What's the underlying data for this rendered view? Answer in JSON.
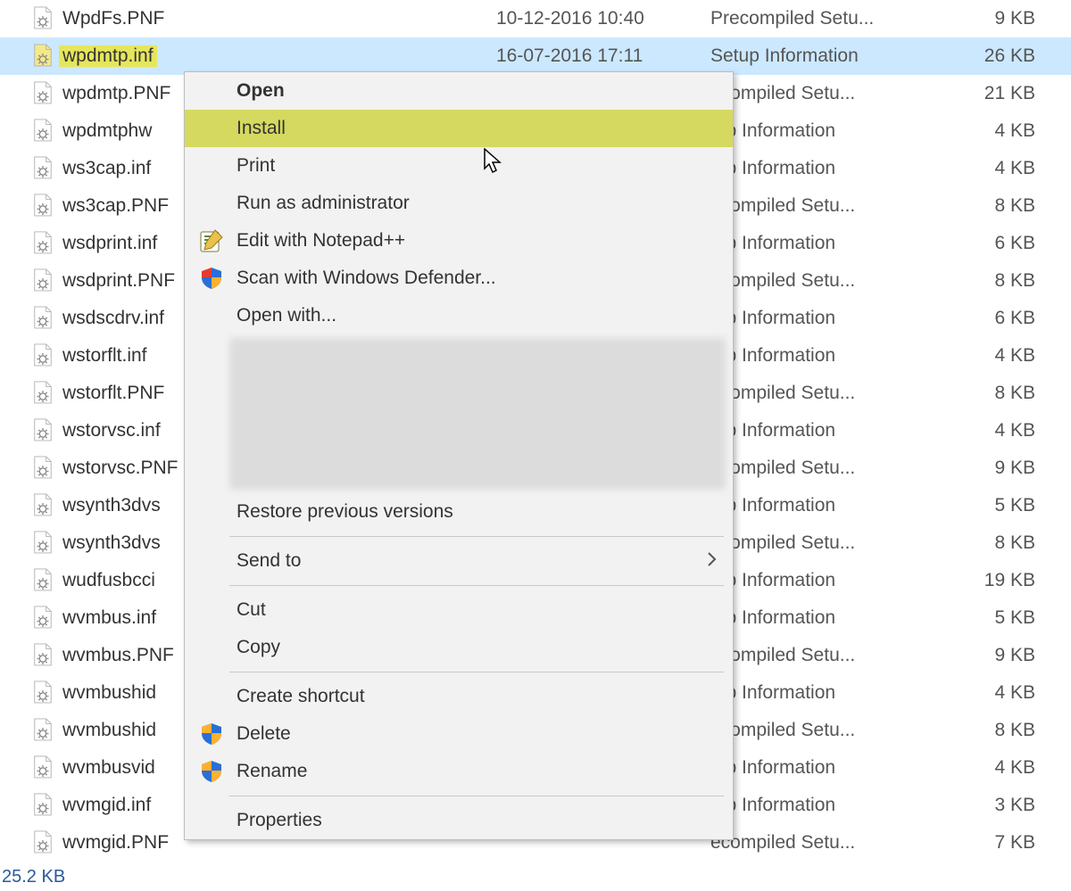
{
  "files": [
    {
      "name": "WpdFs.PNF",
      "date": "10-12-2016 10:40",
      "type": "Precompiled Setu...",
      "size": "9 KB",
      "ftype": "pnf"
    },
    {
      "name": "wpdmtp.inf",
      "date": "16-07-2016 17:11",
      "type": "Setup Information",
      "size": "26 KB",
      "ftype": "inf",
      "selected": true,
      "highlight": true
    },
    {
      "name": "wpdmtp.PNF",
      "date": "",
      "type": "ecompiled Setu...",
      "size": "21 KB",
      "ftype": "pnf"
    },
    {
      "name": "wpdmtphw",
      "date": "",
      "type": "tup Information",
      "size": "4 KB",
      "ftype": "inf"
    },
    {
      "name": "ws3cap.inf",
      "date": "",
      "type": "tup Information",
      "size": "4 KB",
      "ftype": "inf"
    },
    {
      "name": "ws3cap.PNF",
      "date": "",
      "type": "ecompiled Setu...",
      "size": "8 KB",
      "ftype": "pnf"
    },
    {
      "name": "wsdprint.inf",
      "date": "",
      "type": "tup Information",
      "size": "6 KB",
      "ftype": "inf"
    },
    {
      "name": "wsdprint.PNF",
      "date": "",
      "type": "ecompiled Setu...",
      "size": "8 KB",
      "ftype": "pnf"
    },
    {
      "name": "wsdscdrv.inf",
      "date": "",
      "type": "tup Information",
      "size": "6 KB",
      "ftype": "inf"
    },
    {
      "name": "wstorflt.inf",
      "date": "",
      "type": "tup Information",
      "size": "4 KB",
      "ftype": "inf"
    },
    {
      "name": "wstorflt.PNF",
      "date": "",
      "type": "ecompiled Setu...",
      "size": "8 KB",
      "ftype": "pnf"
    },
    {
      "name": "wstorvsc.inf",
      "date": "",
      "type": "tup Information",
      "size": "4 KB",
      "ftype": "inf"
    },
    {
      "name": "wstorvsc.PNF",
      "date": "",
      "type": "ecompiled Setu...",
      "size": "9 KB",
      "ftype": "pnf"
    },
    {
      "name": "wsynth3dvs",
      "date": "",
      "type": "tup Information",
      "size": "5 KB",
      "ftype": "inf"
    },
    {
      "name": "wsynth3dvs",
      "date": "",
      "type": "ecompiled Setu...",
      "size": "8 KB",
      "ftype": "pnf"
    },
    {
      "name": "wudfusbcci",
      "date": "",
      "type": "tup Information",
      "size": "19 KB",
      "ftype": "inf"
    },
    {
      "name": "wvmbus.inf",
      "date": "",
      "type": "tup Information",
      "size": "5 KB",
      "ftype": "inf"
    },
    {
      "name": "wvmbus.PNF",
      "date": "",
      "type": "ecompiled Setu...",
      "size": "9 KB",
      "ftype": "pnf"
    },
    {
      "name": "wvmbushid",
      "date": "",
      "type": "tup Information",
      "size": "4 KB",
      "ftype": "inf"
    },
    {
      "name": "wvmbushid",
      "date": "",
      "type": "ecompiled Setu...",
      "size": "8 KB",
      "ftype": "pnf"
    },
    {
      "name": "wvmbusvid",
      "date": "",
      "type": "tup Information",
      "size": "4 KB",
      "ftype": "inf"
    },
    {
      "name": "wvmgid.inf",
      "date": "",
      "type": "tup Information",
      "size": "3 KB",
      "ftype": "inf"
    },
    {
      "name": "wvmgid.PNF",
      "date": "",
      "type": "ecompiled Setu...",
      "size": "7 KB",
      "ftype": "pnf"
    }
  ],
  "menu": {
    "open": "Open",
    "install": "Install",
    "print": "Print",
    "runas": "Run as administrator",
    "npp": "Edit with Notepad++",
    "defender": "Scan with Windows Defender...",
    "openwith": "Open with...",
    "restore": "Restore previous versions",
    "sendto": "Send to",
    "cut": "Cut",
    "copy": "Copy",
    "shortcut": "Create shortcut",
    "delete": "Delete",
    "rename": "Rename",
    "properties": "Properties"
  },
  "status": "25.2 KB"
}
